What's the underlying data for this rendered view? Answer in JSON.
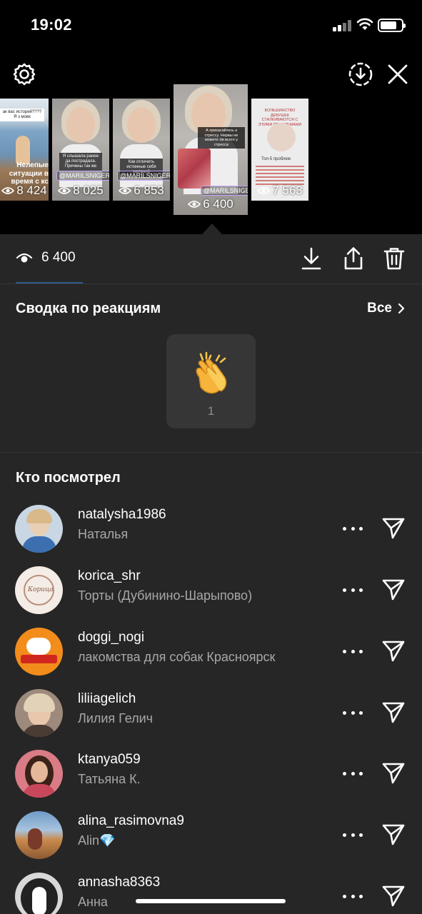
{
  "status": {
    "time": "19:02"
  },
  "thumbnails": [
    {
      "views": "8 424",
      "lines": [
        "Нелепые",
        "ситуации в",
        "время с кс"
      ],
      "topline": "ак вас историй???? Я з мовк"
    },
    {
      "views": "8 025",
      "tag": "@MARILSNIGEREVA",
      "caption": "Я слышала ранее да пострадала. Причины так же"
    },
    {
      "views": "6 853",
      "tag": "@MARILSNIGEREVA",
      "caption": "Как отличить истинные себя желаний"
    },
    {
      "views": "6 400",
      "tag": "@MARILSNIGEREVA",
      "caption": "А прикасайтесь к стрессу. Нервы не можете ли всего у стресса"
    },
    {
      "views": "7 563",
      "caption": "БОЛЬШИНСТВО ДЕВУШЕК СТАЛКИВАЮТСЯ С ЭТИМИ ПРОБЛЕМАМИ",
      "sub": "Топ-5 проблем"
    }
  ],
  "stats": {
    "views": "6 400"
  },
  "reactions": {
    "title": "Сводка по реакциям",
    "all_label": "Все",
    "items": [
      {
        "emoji": "clapping-hands",
        "count": "1"
      }
    ]
  },
  "viewers_title": "Кто посмотрел",
  "viewers": [
    {
      "username": "natalysha1986",
      "name": "Наталья",
      "avatar_color": "#4a7bb0"
    },
    {
      "username": "korica_shr",
      "name": "Торты (Дубинино-Шарыпово)",
      "avatar_color": "#ead8cf"
    },
    {
      "username": "doggi_nogi",
      "name": "лакомства для собак Красноярск",
      "avatar_color": "#f28c1b"
    },
    {
      "username": "liliiagelich",
      "name": "Лилия Гелич",
      "avatar_color": "#8a6b58"
    },
    {
      "username": "ktanya059",
      "name": "Татьяна К.",
      "avatar_color": "#c35b6a"
    },
    {
      "username": "alina_rasimovna9",
      "name": "Alin💎",
      "avatar_color": "#b87b4c"
    },
    {
      "username": "annasha8363",
      "name": "Анна",
      "avatar_color": "#3a3a3a"
    }
  ],
  "colors": {
    "background": "#262626",
    "top_background": "#000000",
    "secondary_text": "#a8a8a8",
    "accent_underline": "#2d5b8b"
  }
}
